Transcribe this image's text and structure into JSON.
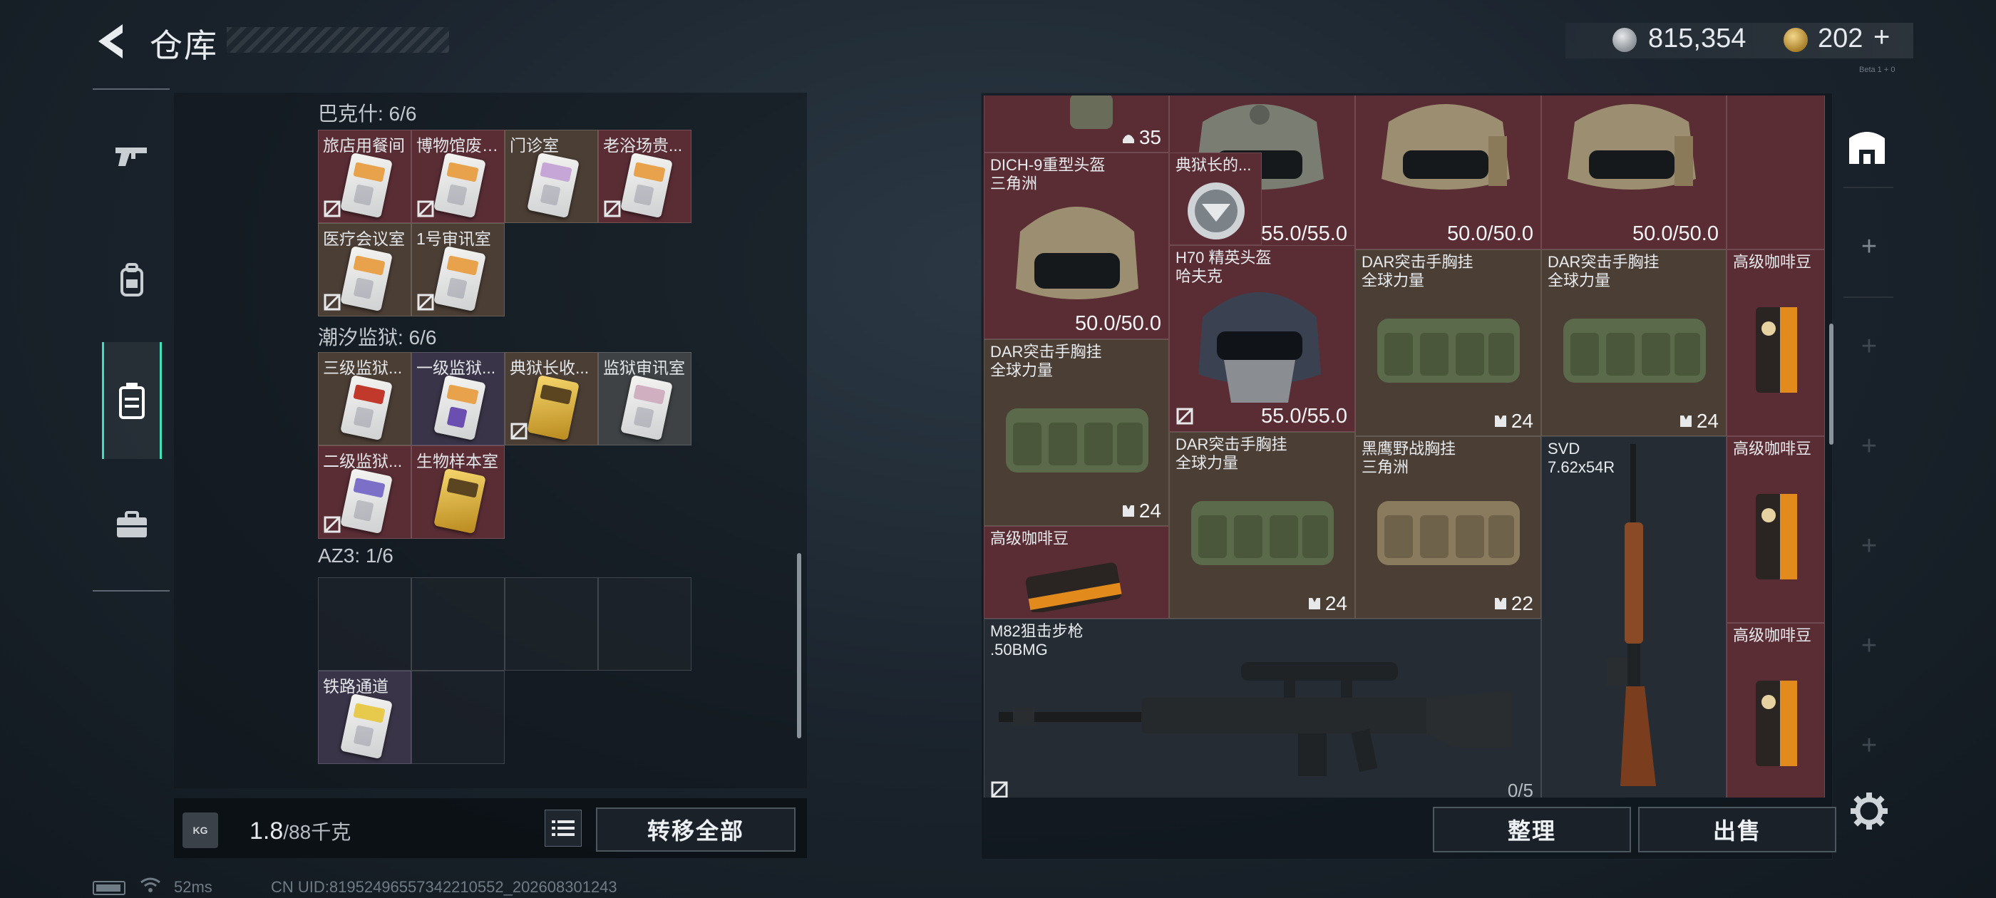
{
  "header": {
    "title": "仓库",
    "currency": [
      {
        "icon": "silver-coin-icon",
        "value": "815,354"
      },
      {
        "icon": "gold-coin-icon",
        "value": "202"
      }
    ],
    "plus_label": "+",
    "tiny_tag": "Beta 1 + 0"
  },
  "nav": [
    {
      "name": "pistol-icon",
      "active": false
    },
    {
      "name": "backpack-icon",
      "active": false
    },
    {
      "name": "keycard-case-icon",
      "active": true
    },
    {
      "name": "briefcase-icon",
      "active": false
    }
  ],
  "left": {
    "sections": [
      {
        "title": "巴克什: 6/6",
        "items": [
          "旅店用餐间",
          "博物馆废弃...",
          "门诊室",
          "老浴场贵...",
          "医疗会议室",
          "1号审讯室"
        ]
      },
      {
        "title": "潮汐监狱: 6/6",
        "items": [
          "三级监狱...",
          "一级监狱...",
          "典狱长收...",
          "监狱审讯室",
          "二级监狱...",
          "生物样本室"
        ]
      },
      {
        "title": "AZ3: 1/6",
        "items": [
          "铁路通道"
        ]
      }
    ],
    "weight": {
      "value": "1.8",
      "max": "/88千克",
      "icon_label": "KG"
    },
    "transfer_all": "转移全部"
  },
  "right": {
    "items": {
      "top_count": "35",
      "helmet1_val": "55.0/55.0",
      "helmet2_val": "50.0/50.0",
      "helmet3_val": "50.0/50.0",
      "dich_name": "DICH-9重型头盔\n三角洲",
      "dich_val": "50.0/50.0",
      "dianyu_name": "典狱长的...",
      "h70_name": "H70 精英头盔\n哈夫克",
      "h70_val": "55.0/55.0",
      "dar1_name": "DAR突击手胸挂\n全球力量",
      "dar1_cnt": "24",
      "dar2_name": "DAR突击手胸挂\n全球力量",
      "dar2_cnt": "24",
      "coffee_name": "高级咖啡豆",
      "dar3_name": "DAR突击手胸挂\n全球力量",
      "dar3_cnt": "24",
      "dar4_name": "DAR突击手胸挂\n全球力量",
      "dar4_cnt": "24",
      "hy_name": "黑鹰野战胸挂\n三角洲",
      "hy_cnt": "22",
      "svd_name": "SVD\n7.62x54R",
      "coffee2_name": "高级咖啡豆",
      "coffee3_name": "高级咖啡豆",
      "coffee4_name": "高级咖啡豆",
      "m82_name": "M82狙击步枪\n.50BMG",
      "m82_ammo": "0/5"
    },
    "sort": "整理",
    "sell": "出售"
  },
  "status": {
    "ping": "52ms",
    "uid": "CN UID:8195249655734221055​2_202608301243"
  }
}
